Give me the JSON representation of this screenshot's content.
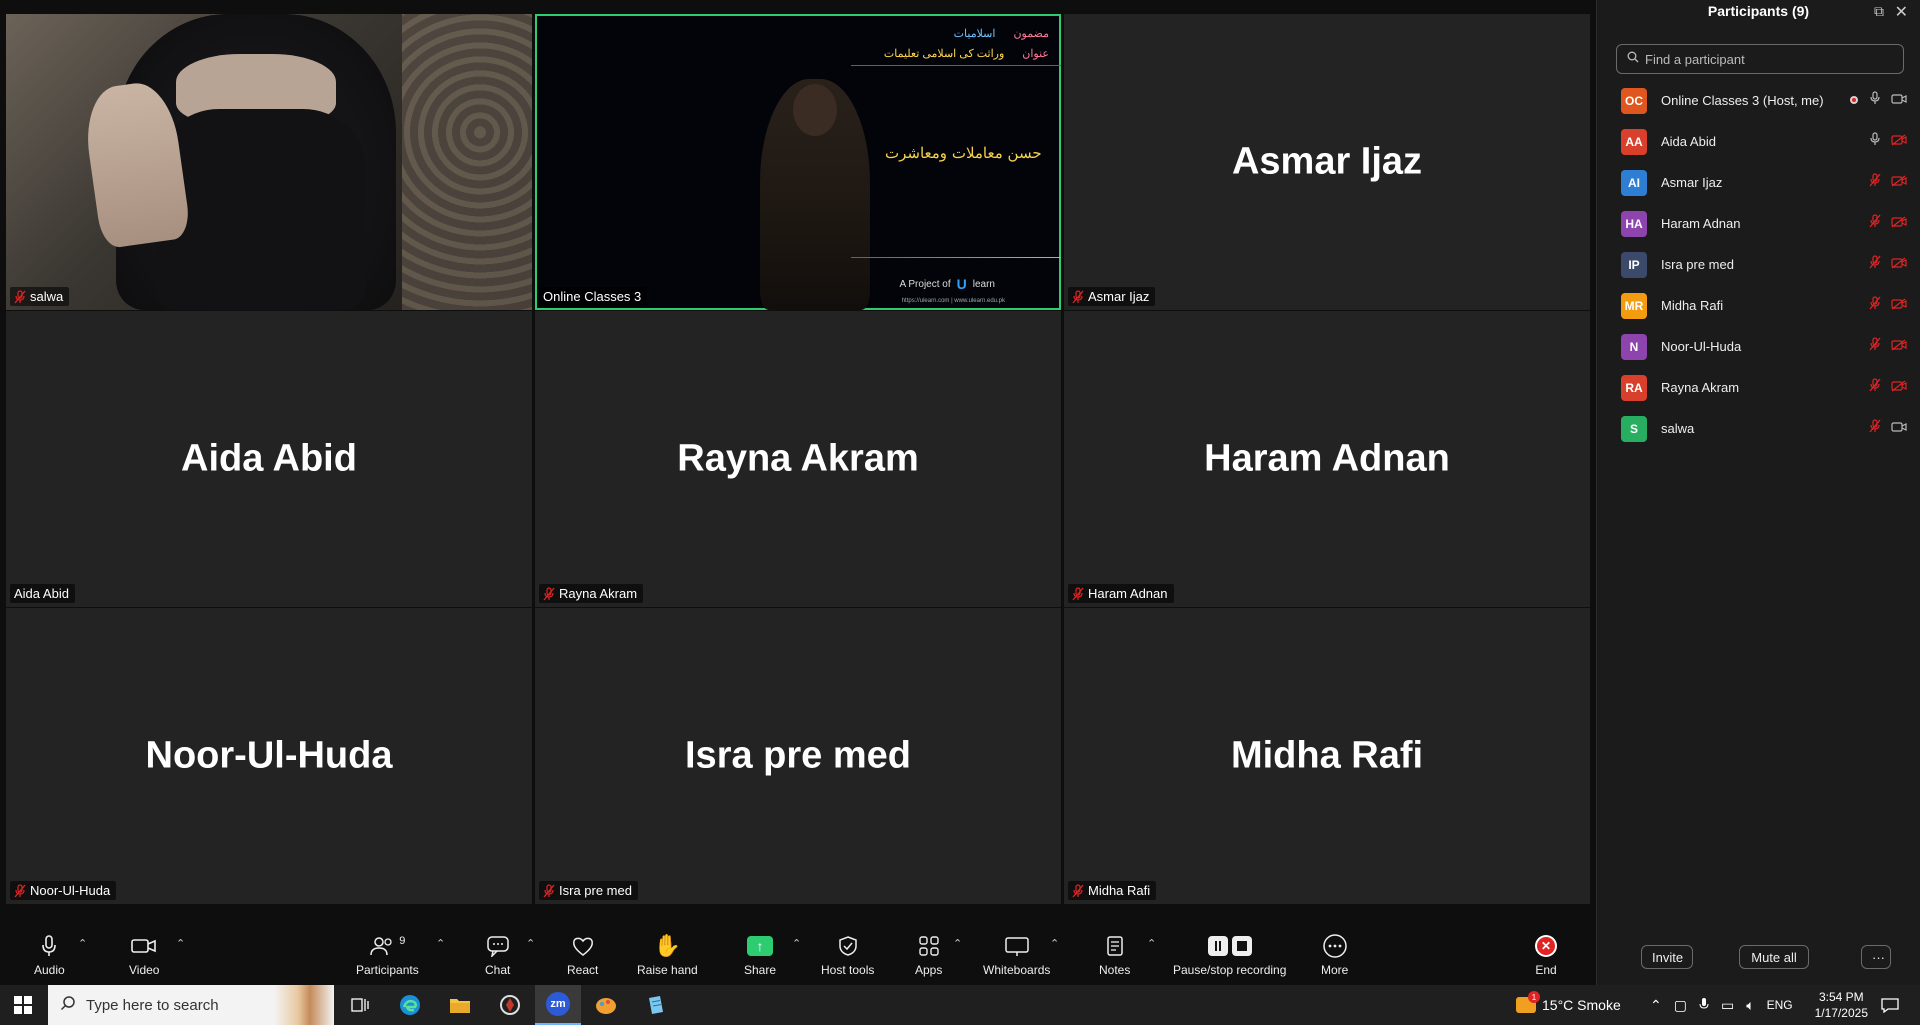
{
  "gallery": {
    "tiles": [
      {
        "name": "salwa",
        "big": ""
      },
      {
        "name": "Online Classes 3",
        "big": ""
      },
      {
        "name": "Asmar Ijaz",
        "big": "Asmar Ijaz"
      },
      {
        "name": "Aida Abid",
        "big": "Aida Abid"
      },
      {
        "name": "Rayna Akram",
        "big": "Rayna Akram"
      },
      {
        "name": "Haram Adnan",
        "big": "Haram Adnan"
      },
      {
        "name": "Noor-Ul-Huda",
        "big": "Noor-Ul-Huda"
      },
      {
        "name": "Isra pre med",
        "big": "Isra pre med"
      },
      {
        "name": "Midha Rafi",
        "big": "Midha Rafi"
      }
    ],
    "slide": {
      "k1": "مضمون",
      "v1": "اسلامیات",
      "k2": "عنوان",
      "v2": "وراثت کی اسلامی تعلیمات",
      "title": "حسن معاملات ومعاشرت",
      "brand_prefix": "A Project of",
      "brand_name": "learn",
      "footer": "https://ulearn.com | www.ulearn.edu.pk"
    }
  },
  "panel": {
    "title": "Participants (9)",
    "search_placeholder": "Find a participant",
    "participants": [
      {
        "initials": "OC",
        "name": "Online Classes 3 (Host, me)",
        "color": "#e0561f"
      },
      {
        "initials": "AA",
        "name": "Aida Abid",
        "color": "#d8402b"
      },
      {
        "initials": "AI",
        "name": "Asmar Ijaz",
        "color": "#2e7fd4"
      },
      {
        "initials": "HA",
        "name": "Haram Adnan",
        "color": "#8e44ad"
      },
      {
        "initials": "IP",
        "name": "Isra pre med",
        "color": "#3b4a6b"
      },
      {
        "initials": "MR",
        "name": "Midha Rafi",
        "color": "#f39c12"
      },
      {
        "initials": "N",
        "name": "Noor-Ul-Huda",
        "color": "#8e44ad"
      },
      {
        "initials": "RA",
        "name": "Rayna Akram",
        "color": "#d8402b"
      },
      {
        "initials": "S",
        "name": "salwa",
        "color": "#27ae60"
      }
    ],
    "invite": "Invite",
    "mute_all": "Mute all",
    "more": "···"
  },
  "toolbar": {
    "audio": "Audio",
    "video": "Video",
    "participants": "Participants",
    "participants_count": "9",
    "chat": "Chat",
    "react": "React",
    "raise_hand": "Raise hand",
    "share": "Share",
    "host_tools": "Host tools",
    "apps": "Apps",
    "whiteboards": "Whiteboards",
    "notes": "Notes",
    "recording": "Pause/stop recording",
    "more": "More",
    "end": "End"
  },
  "taskbar": {
    "search_placeholder": "Type here to search",
    "weather": "15°C  Smoke",
    "lang": "ENG",
    "time": "3:54 PM",
    "date": "1/17/2025",
    "notif_badge": "1"
  }
}
